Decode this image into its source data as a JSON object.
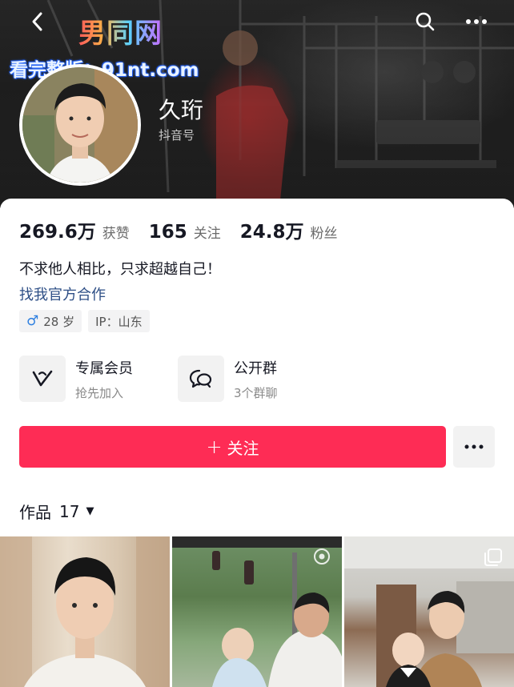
{
  "watermark": {
    "logo": "男同网",
    "url": "看完整版：91nt.com"
  },
  "profile": {
    "nickname": "久珩",
    "douyin_id_label": "抖音号",
    "bio": "不求他人相比，只求超越自己！",
    "biz_link": "找我官方合作"
  },
  "stats": [
    {
      "value": "269.6万",
      "label": "获赞"
    },
    {
      "value": "165",
      "label": "关注"
    },
    {
      "value": "24.8万",
      "label": "粉丝"
    }
  ],
  "tags": {
    "gender_symbol": "♂",
    "age": "28 岁",
    "ip": "IP：山东"
  },
  "services": [
    {
      "title": "专属会员",
      "subtitle": "抢先加入",
      "icon": "v-logo-icon"
    },
    {
      "title": "公开群",
      "subtitle": "3个群聊",
      "icon": "chat-bubbles-icon"
    }
  ],
  "actions": {
    "follow_label": "关注",
    "follow_plus": "+"
  },
  "works": {
    "label": "作品",
    "count": "17"
  },
  "colors": {
    "accent": "#fe2c55",
    "link": "#2e4f86",
    "male": "#2d7fe0"
  }
}
